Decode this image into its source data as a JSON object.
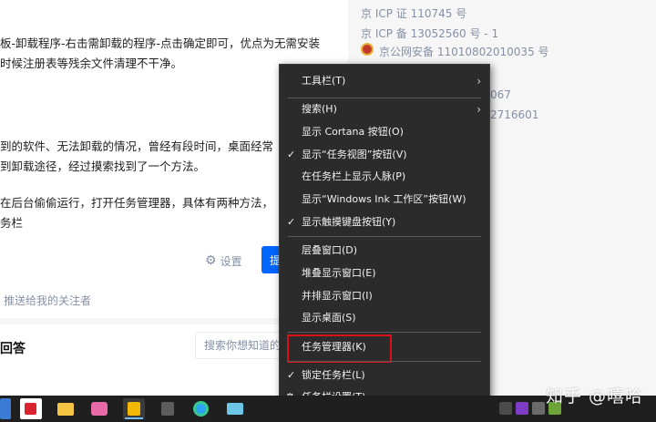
{
  "article": {
    "para1_line1": "板-卸载程序-右击需卸载的程序-点击确定即可，优点为无需安装",
    "para1_line2": "时候注册表等残余文件清理不干净。",
    "para2_line1": "到的软件、无法卸载的情况，曾经有段时间，桌面经常",
    "para2_line2": "到卸载途径，经过摸索找到了一个方法。",
    "para3_line1": "在后台偷偷运行，打开任务管理器，具体有两种方法，",
    "para3_line2": "务栏",
    "settings_label": "设置",
    "settings_icon": "gear-icon",
    "blue_button_label": "提",
    "share_text": "推送给我的关注者",
    "answers_title": "回答",
    "answers_search_placeholder": "搜索你想知道的回答"
  },
  "sidebar": {
    "icp1": "京 ICP 证 110745 号",
    "icp2": "京 ICP 备 13052560 号 - 1",
    "police": "京公网安备 11010802010035 号",
    "frag1": "067",
    "frag2": "2716601"
  },
  "watermark": "知乎 @嘻哈",
  "menu": {
    "toolbars": "工具栏(T)",
    "search": "搜索(H)",
    "cortana": "显示 Cortana 按钮(O)",
    "task_view": "显示“任务视图”按钮(V)",
    "people": "在任务栏上显示人脉(P)",
    "ink": "显示“Windows Ink 工作区”按钮(W)",
    "touch_kb": "显示触摸键盘按钮(Y)",
    "cascade": "层叠窗口(D)",
    "stacked": "堆叠显示窗口(E)",
    "side_by_side": "并排显示窗口(I)",
    "show_desktop": "显示桌面(S)",
    "task_manager": "任务管理器(K)",
    "lock": "锁定任务栏(L)",
    "settings": "任务栏设置(T)",
    "check": "✓",
    "submenu_arrow": "›",
    "gear": "⚙"
  },
  "highlight_color": "#d9101a",
  "menu_bg": "#2b2b2b",
  "taskbar_bg": "#1f1f1f"
}
